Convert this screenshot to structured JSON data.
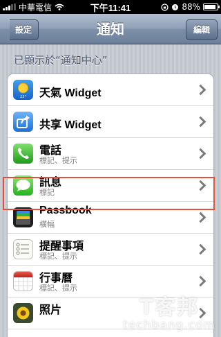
{
  "status_bar": {
    "carrier": "中華電信",
    "time": "下午11:41",
    "battery_text": "88%",
    "battery_level": 0.88
  },
  "nav": {
    "back_label": "設定",
    "title": "通知",
    "edit_label": "編輯"
  },
  "section": {
    "header": "已顯示於“通知中心”"
  },
  "items": [
    {
      "title": "天氣 Widget",
      "subtitle": "",
      "icon": "weather-icon"
    },
    {
      "title": "共享 Widget",
      "subtitle": "",
      "icon": "share-icon"
    },
    {
      "title": "電話",
      "subtitle": "標記、提示",
      "icon": "phone-icon"
    },
    {
      "title": "訊息",
      "subtitle": "標記",
      "icon": "messages-icon"
    },
    {
      "title": "Passbook",
      "subtitle": "橫幅",
      "icon": "passbook-icon"
    },
    {
      "title": "提醒事項",
      "subtitle": "標記、提示",
      "icon": "reminders-icon"
    },
    {
      "title": "行事曆",
      "subtitle": "標記、提示",
      "icon": "calendar-icon"
    },
    {
      "title": "照片",
      "subtitle": "",
      "icon": "photos-icon"
    }
  ],
  "colors": {
    "highlight": "#e2503b",
    "nav_bar": "#7d90a8"
  },
  "watermark": {
    "line1": "T客邦",
    "line2": "techbang.com"
  }
}
